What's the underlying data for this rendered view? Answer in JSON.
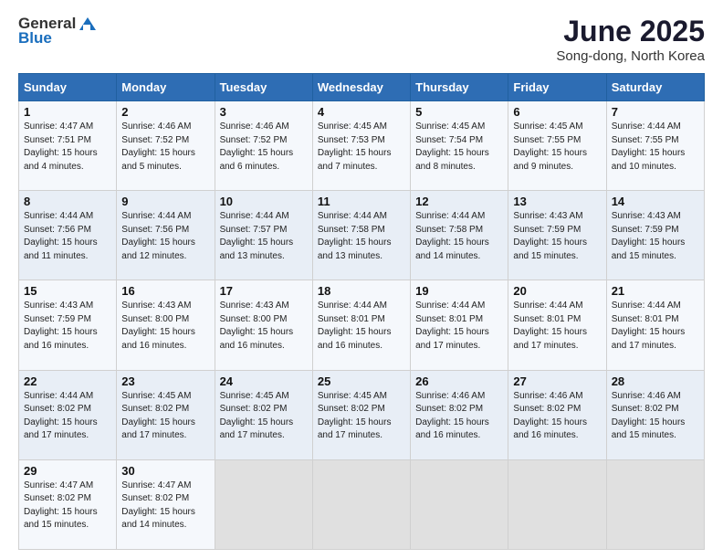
{
  "logo": {
    "general": "General",
    "blue": "Blue"
  },
  "title": "June 2025",
  "location": "Song-dong, North Korea",
  "days_header": [
    "Sunday",
    "Monday",
    "Tuesday",
    "Wednesday",
    "Thursday",
    "Friday",
    "Saturday"
  ],
  "weeks": [
    [
      {
        "day": "1",
        "sunrise": "4:47 AM",
        "sunset": "7:51 PM",
        "daylight": "15 hours and 4 minutes."
      },
      {
        "day": "2",
        "sunrise": "4:46 AM",
        "sunset": "7:52 PM",
        "daylight": "15 hours and 5 minutes."
      },
      {
        "day": "3",
        "sunrise": "4:46 AM",
        "sunset": "7:52 PM",
        "daylight": "15 hours and 6 minutes."
      },
      {
        "day": "4",
        "sunrise": "4:45 AM",
        "sunset": "7:53 PM",
        "daylight": "15 hours and 7 minutes."
      },
      {
        "day": "5",
        "sunrise": "4:45 AM",
        "sunset": "7:54 PM",
        "daylight": "15 hours and 8 minutes."
      },
      {
        "day": "6",
        "sunrise": "4:45 AM",
        "sunset": "7:55 PM",
        "daylight": "15 hours and 9 minutes."
      },
      {
        "day": "7",
        "sunrise": "4:44 AM",
        "sunset": "7:55 PM",
        "daylight": "15 hours and 10 minutes."
      }
    ],
    [
      {
        "day": "8",
        "sunrise": "4:44 AM",
        "sunset": "7:56 PM",
        "daylight": "15 hours and 11 minutes."
      },
      {
        "day": "9",
        "sunrise": "4:44 AM",
        "sunset": "7:56 PM",
        "daylight": "15 hours and 12 minutes."
      },
      {
        "day": "10",
        "sunrise": "4:44 AM",
        "sunset": "7:57 PM",
        "daylight": "15 hours and 13 minutes."
      },
      {
        "day": "11",
        "sunrise": "4:44 AM",
        "sunset": "7:58 PM",
        "daylight": "15 hours and 13 minutes."
      },
      {
        "day": "12",
        "sunrise": "4:44 AM",
        "sunset": "7:58 PM",
        "daylight": "15 hours and 14 minutes."
      },
      {
        "day": "13",
        "sunrise": "4:43 AM",
        "sunset": "7:59 PM",
        "daylight": "15 hours and 15 minutes."
      },
      {
        "day": "14",
        "sunrise": "4:43 AM",
        "sunset": "7:59 PM",
        "daylight": "15 hours and 15 minutes."
      }
    ],
    [
      {
        "day": "15",
        "sunrise": "4:43 AM",
        "sunset": "7:59 PM",
        "daylight": "15 hours and 16 minutes."
      },
      {
        "day": "16",
        "sunrise": "4:43 AM",
        "sunset": "8:00 PM",
        "daylight": "15 hours and 16 minutes."
      },
      {
        "day": "17",
        "sunrise": "4:43 AM",
        "sunset": "8:00 PM",
        "daylight": "15 hours and 16 minutes."
      },
      {
        "day": "18",
        "sunrise": "4:44 AM",
        "sunset": "8:01 PM",
        "daylight": "15 hours and 16 minutes."
      },
      {
        "day": "19",
        "sunrise": "4:44 AM",
        "sunset": "8:01 PM",
        "daylight": "15 hours and 17 minutes."
      },
      {
        "day": "20",
        "sunrise": "4:44 AM",
        "sunset": "8:01 PM",
        "daylight": "15 hours and 17 minutes."
      },
      {
        "day": "21",
        "sunrise": "4:44 AM",
        "sunset": "8:01 PM",
        "daylight": "15 hours and 17 minutes."
      }
    ],
    [
      {
        "day": "22",
        "sunrise": "4:44 AM",
        "sunset": "8:02 PM",
        "daylight": "15 hours and 17 minutes."
      },
      {
        "day": "23",
        "sunrise": "4:45 AM",
        "sunset": "8:02 PM",
        "daylight": "15 hours and 17 minutes."
      },
      {
        "day": "24",
        "sunrise": "4:45 AM",
        "sunset": "8:02 PM",
        "daylight": "15 hours and 17 minutes."
      },
      {
        "day": "25",
        "sunrise": "4:45 AM",
        "sunset": "8:02 PM",
        "daylight": "15 hours and 17 minutes."
      },
      {
        "day": "26",
        "sunrise": "4:46 AM",
        "sunset": "8:02 PM",
        "daylight": "15 hours and 16 minutes."
      },
      {
        "day": "27",
        "sunrise": "4:46 AM",
        "sunset": "8:02 PM",
        "daylight": "15 hours and 16 minutes."
      },
      {
        "day": "28",
        "sunrise": "4:46 AM",
        "sunset": "8:02 PM",
        "daylight": "15 hours and 15 minutes."
      }
    ],
    [
      {
        "day": "29",
        "sunrise": "4:47 AM",
        "sunset": "8:02 PM",
        "daylight": "15 hours and 15 minutes."
      },
      {
        "day": "30",
        "sunrise": "4:47 AM",
        "sunset": "8:02 PM",
        "daylight": "15 hours and 14 minutes."
      },
      null,
      null,
      null,
      null,
      null
    ]
  ]
}
